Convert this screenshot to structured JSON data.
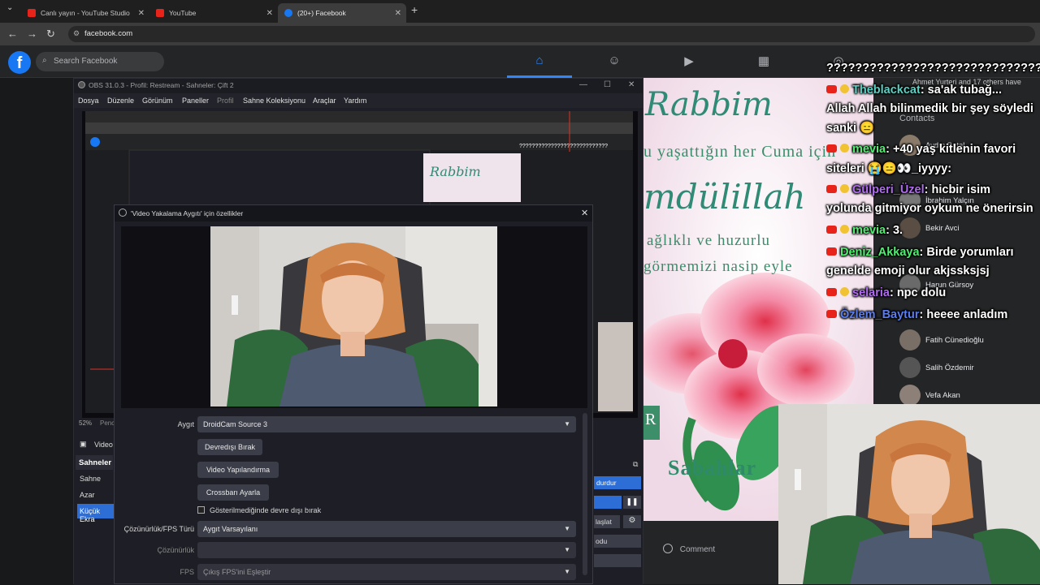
{
  "browser": {
    "tabs": [
      {
        "title": "Canlı yayın - YouTube Studio",
        "active": false,
        "favicon_color": "#e8231a"
      },
      {
        "title": "YouTube",
        "active": false,
        "favicon_color": "#e8231a"
      },
      {
        "title": "(20+) Facebook",
        "active": true,
        "favicon_color": "#1877f2"
      }
    ],
    "url": "facebook.com"
  },
  "facebook": {
    "logo": "f",
    "search_placeholder": "Search Facebook",
    "nav_icons": [
      "home-icon",
      "friends-icon",
      "watch-icon",
      "marketplace-icon",
      "groups-icon"
    ],
    "accent": "#1877f2",
    "contacts_header": "Contacts",
    "notification": "Ahmet Yurteri and 17 others have",
    "contacts": [
      "Aydın Batal",
      "İbrahim Yalçın",
      "Bekir Avci",
      "Harun Gürsoy",
      "Fatih Cünedioğlu",
      "Salih Özdemir",
      "Vefa Akan"
    ],
    "comment_label": "Comment",
    "post_text": {
      "line1": "Rabbim",
      "line2": "u yaşattığın her Cuma için",
      "line3": "mdülillah",
      "line4": "ağlıklı ve huzurlu",
      "line5": "görmemizi nasip eyle",
      "line6": "Sabahlar"
    }
  },
  "obs": {
    "title": "OBS 31.0.3 - Profil: Restream - Sahneler: Çift 2",
    "menu": [
      "Dosya",
      "Düzenle",
      "Görünüm",
      "Paneller",
      "Profil",
      "Sahne Koleksiyonu",
      "Araçlar",
      "Yardım"
    ],
    "zoom": "52%",
    "zoom_suffix": "Pence",
    "sources_label": "Video",
    "scenes_header": "Sahneler",
    "scenes": [
      "Sahne",
      "Azar",
      "Küçük Ekra"
    ],
    "controls": [
      "durdur",
      "laşlat",
      "odu"
    ]
  },
  "dialog": {
    "title": "'Video Yakalama Aygıtı' için özellikler",
    "device_label": "Aygıt",
    "device_value": "DroidCam Source 3",
    "buttons": [
      "Devredışı Bırak",
      "Video Yapılandırma",
      "Crossbarı Ayarla"
    ],
    "checkbox_label": "Gösterilmediğinde devre dışı bırak",
    "resfps_label": "Çözünürlük/FPS Türü",
    "resfps_value": "Aygıt Varsayılanı",
    "res_label": "Çözünürlük",
    "res_value": "",
    "fps_label": "FPS",
    "fps_value": "Çıkış FPS'ini Eşleştir"
  },
  "chat": {
    "header": "??????????????????????????????????",
    "lines": [
      {
        "user": "Theblackcat",
        "user_color": "#5ad1c4",
        "msg": ": sa'ak tubağ..."
      },
      {
        "user": "",
        "user_color": "#ffffff",
        "msg": "Allah Allah bilinmedik bir şey söyledi"
      },
      {
        "user": "",
        "user_color": "#ffffff",
        "msg": "sanki 😑"
      },
      {
        "user": "mevia",
        "user_color": "#4ef070",
        "msg": ": +40 yaş kitlenin favori"
      },
      {
        "user": "",
        "user_color": "#ffffff",
        "msg": "siteleri 😭😑👀_iyyyy:"
      },
      {
        "user": "Gülperi_Üzel",
        "user_color": "#b06cf0",
        "msg": ": hicbir isim"
      },
      {
        "user": "",
        "user_color": "#ffffff",
        "msg": "yolunda gitmiyor oykum ne önerirsin"
      },
      {
        "user": "mevia",
        "user_color": "#4ef070",
        "msg": ": 3."
      },
      {
        "user": "Deniz_Akkaya",
        "user_color": "#4ef070",
        "msg": ": Birde yorumları"
      },
      {
        "user": "",
        "user_color": "#ffffff",
        "msg": "genelde emoji olur akjssksjsj"
      },
      {
        "user": "selaria",
        "user_color": "#b06cf0",
        "msg": ": npc dolu"
      },
      {
        "user": "Özlem_Baytur",
        "user_color": "#5a7df0",
        "msg": ": heeee anladım"
      }
    ]
  }
}
